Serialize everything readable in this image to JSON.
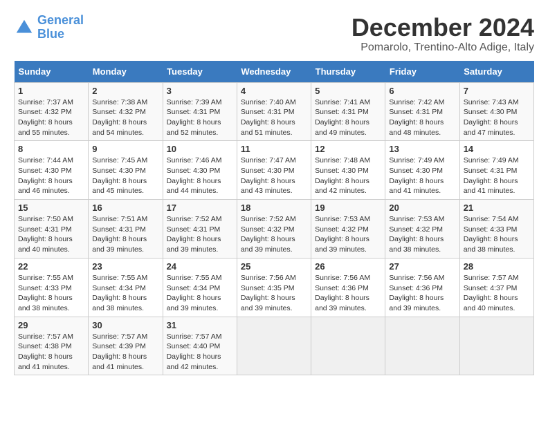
{
  "header": {
    "logo_line1": "General",
    "logo_line2": "Blue",
    "month": "December 2024",
    "location": "Pomarolo, Trentino-Alto Adige, Italy"
  },
  "weekdays": [
    "Sunday",
    "Monday",
    "Tuesday",
    "Wednesday",
    "Thursday",
    "Friday",
    "Saturday"
  ],
  "weeks": [
    [
      {
        "day": 1,
        "info": "Sunrise: 7:37 AM\nSunset: 4:32 PM\nDaylight: 8 hours and 55 minutes."
      },
      {
        "day": 2,
        "info": "Sunrise: 7:38 AM\nSunset: 4:32 PM\nDaylight: 8 hours and 54 minutes."
      },
      {
        "day": 3,
        "info": "Sunrise: 7:39 AM\nSunset: 4:31 PM\nDaylight: 8 hours and 52 minutes."
      },
      {
        "day": 4,
        "info": "Sunrise: 7:40 AM\nSunset: 4:31 PM\nDaylight: 8 hours and 51 minutes."
      },
      {
        "day": 5,
        "info": "Sunrise: 7:41 AM\nSunset: 4:31 PM\nDaylight: 8 hours and 49 minutes."
      },
      {
        "day": 6,
        "info": "Sunrise: 7:42 AM\nSunset: 4:31 PM\nDaylight: 8 hours and 48 minutes."
      },
      {
        "day": 7,
        "info": "Sunrise: 7:43 AM\nSunset: 4:30 PM\nDaylight: 8 hours and 47 minutes."
      }
    ],
    [
      {
        "day": 8,
        "info": "Sunrise: 7:44 AM\nSunset: 4:30 PM\nDaylight: 8 hours and 46 minutes."
      },
      {
        "day": 9,
        "info": "Sunrise: 7:45 AM\nSunset: 4:30 PM\nDaylight: 8 hours and 45 minutes."
      },
      {
        "day": 10,
        "info": "Sunrise: 7:46 AM\nSunset: 4:30 PM\nDaylight: 8 hours and 44 minutes."
      },
      {
        "day": 11,
        "info": "Sunrise: 7:47 AM\nSunset: 4:30 PM\nDaylight: 8 hours and 43 minutes."
      },
      {
        "day": 12,
        "info": "Sunrise: 7:48 AM\nSunset: 4:30 PM\nDaylight: 8 hours and 42 minutes."
      },
      {
        "day": 13,
        "info": "Sunrise: 7:49 AM\nSunset: 4:30 PM\nDaylight: 8 hours and 41 minutes."
      },
      {
        "day": 14,
        "info": "Sunrise: 7:49 AM\nSunset: 4:31 PM\nDaylight: 8 hours and 41 minutes."
      }
    ],
    [
      {
        "day": 15,
        "info": "Sunrise: 7:50 AM\nSunset: 4:31 PM\nDaylight: 8 hours and 40 minutes."
      },
      {
        "day": 16,
        "info": "Sunrise: 7:51 AM\nSunset: 4:31 PM\nDaylight: 8 hours and 39 minutes."
      },
      {
        "day": 17,
        "info": "Sunrise: 7:52 AM\nSunset: 4:31 PM\nDaylight: 8 hours and 39 minutes."
      },
      {
        "day": 18,
        "info": "Sunrise: 7:52 AM\nSunset: 4:32 PM\nDaylight: 8 hours and 39 minutes."
      },
      {
        "day": 19,
        "info": "Sunrise: 7:53 AM\nSunset: 4:32 PM\nDaylight: 8 hours and 39 minutes."
      },
      {
        "day": 20,
        "info": "Sunrise: 7:53 AM\nSunset: 4:32 PM\nDaylight: 8 hours and 38 minutes."
      },
      {
        "day": 21,
        "info": "Sunrise: 7:54 AM\nSunset: 4:33 PM\nDaylight: 8 hours and 38 minutes."
      }
    ],
    [
      {
        "day": 22,
        "info": "Sunrise: 7:55 AM\nSunset: 4:33 PM\nDaylight: 8 hours and 38 minutes."
      },
      {
        "day": 23,
        "info": "Sunrise: 7:55 AM\nSunset: 4:34 PM\nDaylight: 8 hours and 38 minutes."
      },
      {
        "day": 24,
        "info": "Sunrise: 7:55 AM\nSunset: 4:34 PM\nDaylight: 8 hours and 39 minutes."
      },
      {
        "day": 25,
        "info": "Sunrise: 7:56 AM\nSunset: 4:35 PM\nDaylight: 8 hours and 39 minutes."
      },
      {
        "day": 26,
        "info": "Sunrise: 7:56 AM\nSunset: 4:36 PM\nDaylight: 8 hours and 39 minutes."
      },
      {
        "day": 27,
        "info": "Sunrise: 7:56 AM\nSunset: 4:36 PM\nDaylight: 8 hours and 39 minutes."
      },
      {
        "day": 28,
        "info": "Sunrise: 7:57 AM\nSunset: 4:37 PM\nDaylight: 8 hours and 40 minutes."
      }
    ],
    [
      {
        "day": 29,
        "info": "Sunrise: 7:57 AM\nSunset: 4:38 PM\nDaylight: 8 hours and 41 minutes."
      },
      {
        "day": 30,
        "info": "Sunrise: 7:57 AM\nSunset: 4:39 PM\nDaylight: 8 hours and 41 minutes."
      },
      {
        "day": 31,
        "info": "Sunrise: 7:57 AM\nSunset: 4:40 PM\nDaylight: 8 hours and 42 minutes."
      },
      null,
      null,
      null,
      null
    ]
  ]
}
